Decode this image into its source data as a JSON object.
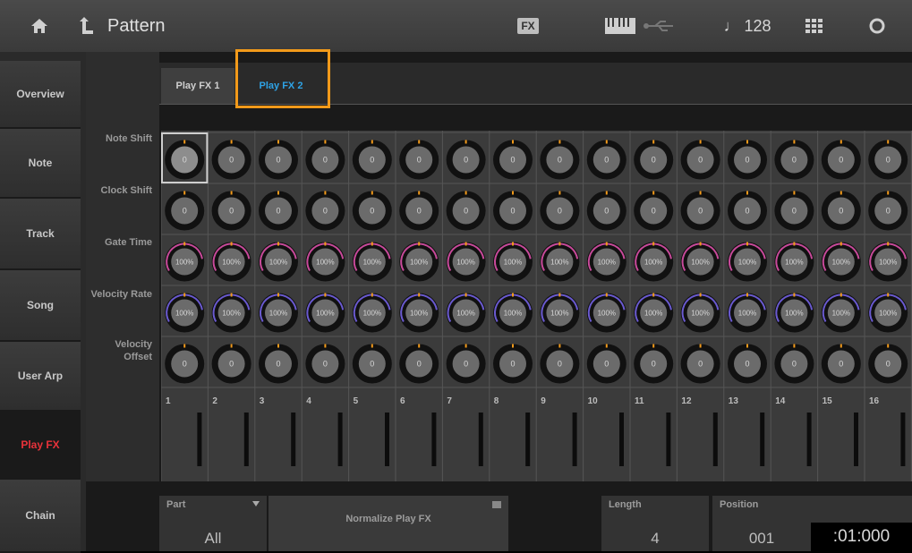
{
  "topbar": {
    "title": "Pattern",
    "fx_badge": "FX",
    "tempo": "♩ 128"
  },
  "sidebar": {
    "items": [
      {
        "label": "Overview"
      },
      {
        "label": "Note"
      },
      {
        "label": "Track"
      },
      {
        "label": "Song"
      },
      {
        "label": "User Arp"
      },
      {
        "label": "Play FX",
        "active": true
      },
      {
        "label": "Chain"
      }
    ]
  },
  "tabs": [
    {
      "label": "Play FX 1"
    },
    {
      "label": "Play FX 2",
      "selected": true
    }
  ],
  "rows": [
    {
      "label": "Note Shift",
      "value": "0"
    },
    {
      "label": "Clock Shift",
      "value": "0"
    },
    {
      "label": "Gate Time",
      "value": "100%"
    },
    {
      "label": "Velocity Rate",
      "value": "100%"
    },
    {
      "label": "Velocity Offset",
      "value": "0"
    }
  ],
  "columns": [
    "1",
    "2",
    "3",
    "4",
    "5",
    "6",
    "7",
    "8",
    "9",
    "10",
    "11",
    "12",
    "13",
    "14",
    "15",
    "16"
  ],
  "bottom": {
    "part_label": "Part",
    "part_value": "All",
    "normalize_label": "Normalize Play FX",
    "length_label": "Length",
    "length_value": "4",
    "position_label": "Position",
    "position_measure": "001",
    "position_beat": ":01:000"
  },
  "colors": {
    "accent_red": "#e8323a",
    "tab_blue": "#2ea3e6",
    "highlight_orange": "#f29a1a",
    "gate_arc": "#c84a9a",
    "velocity_arc": "#6a5ad0"
  }
}
